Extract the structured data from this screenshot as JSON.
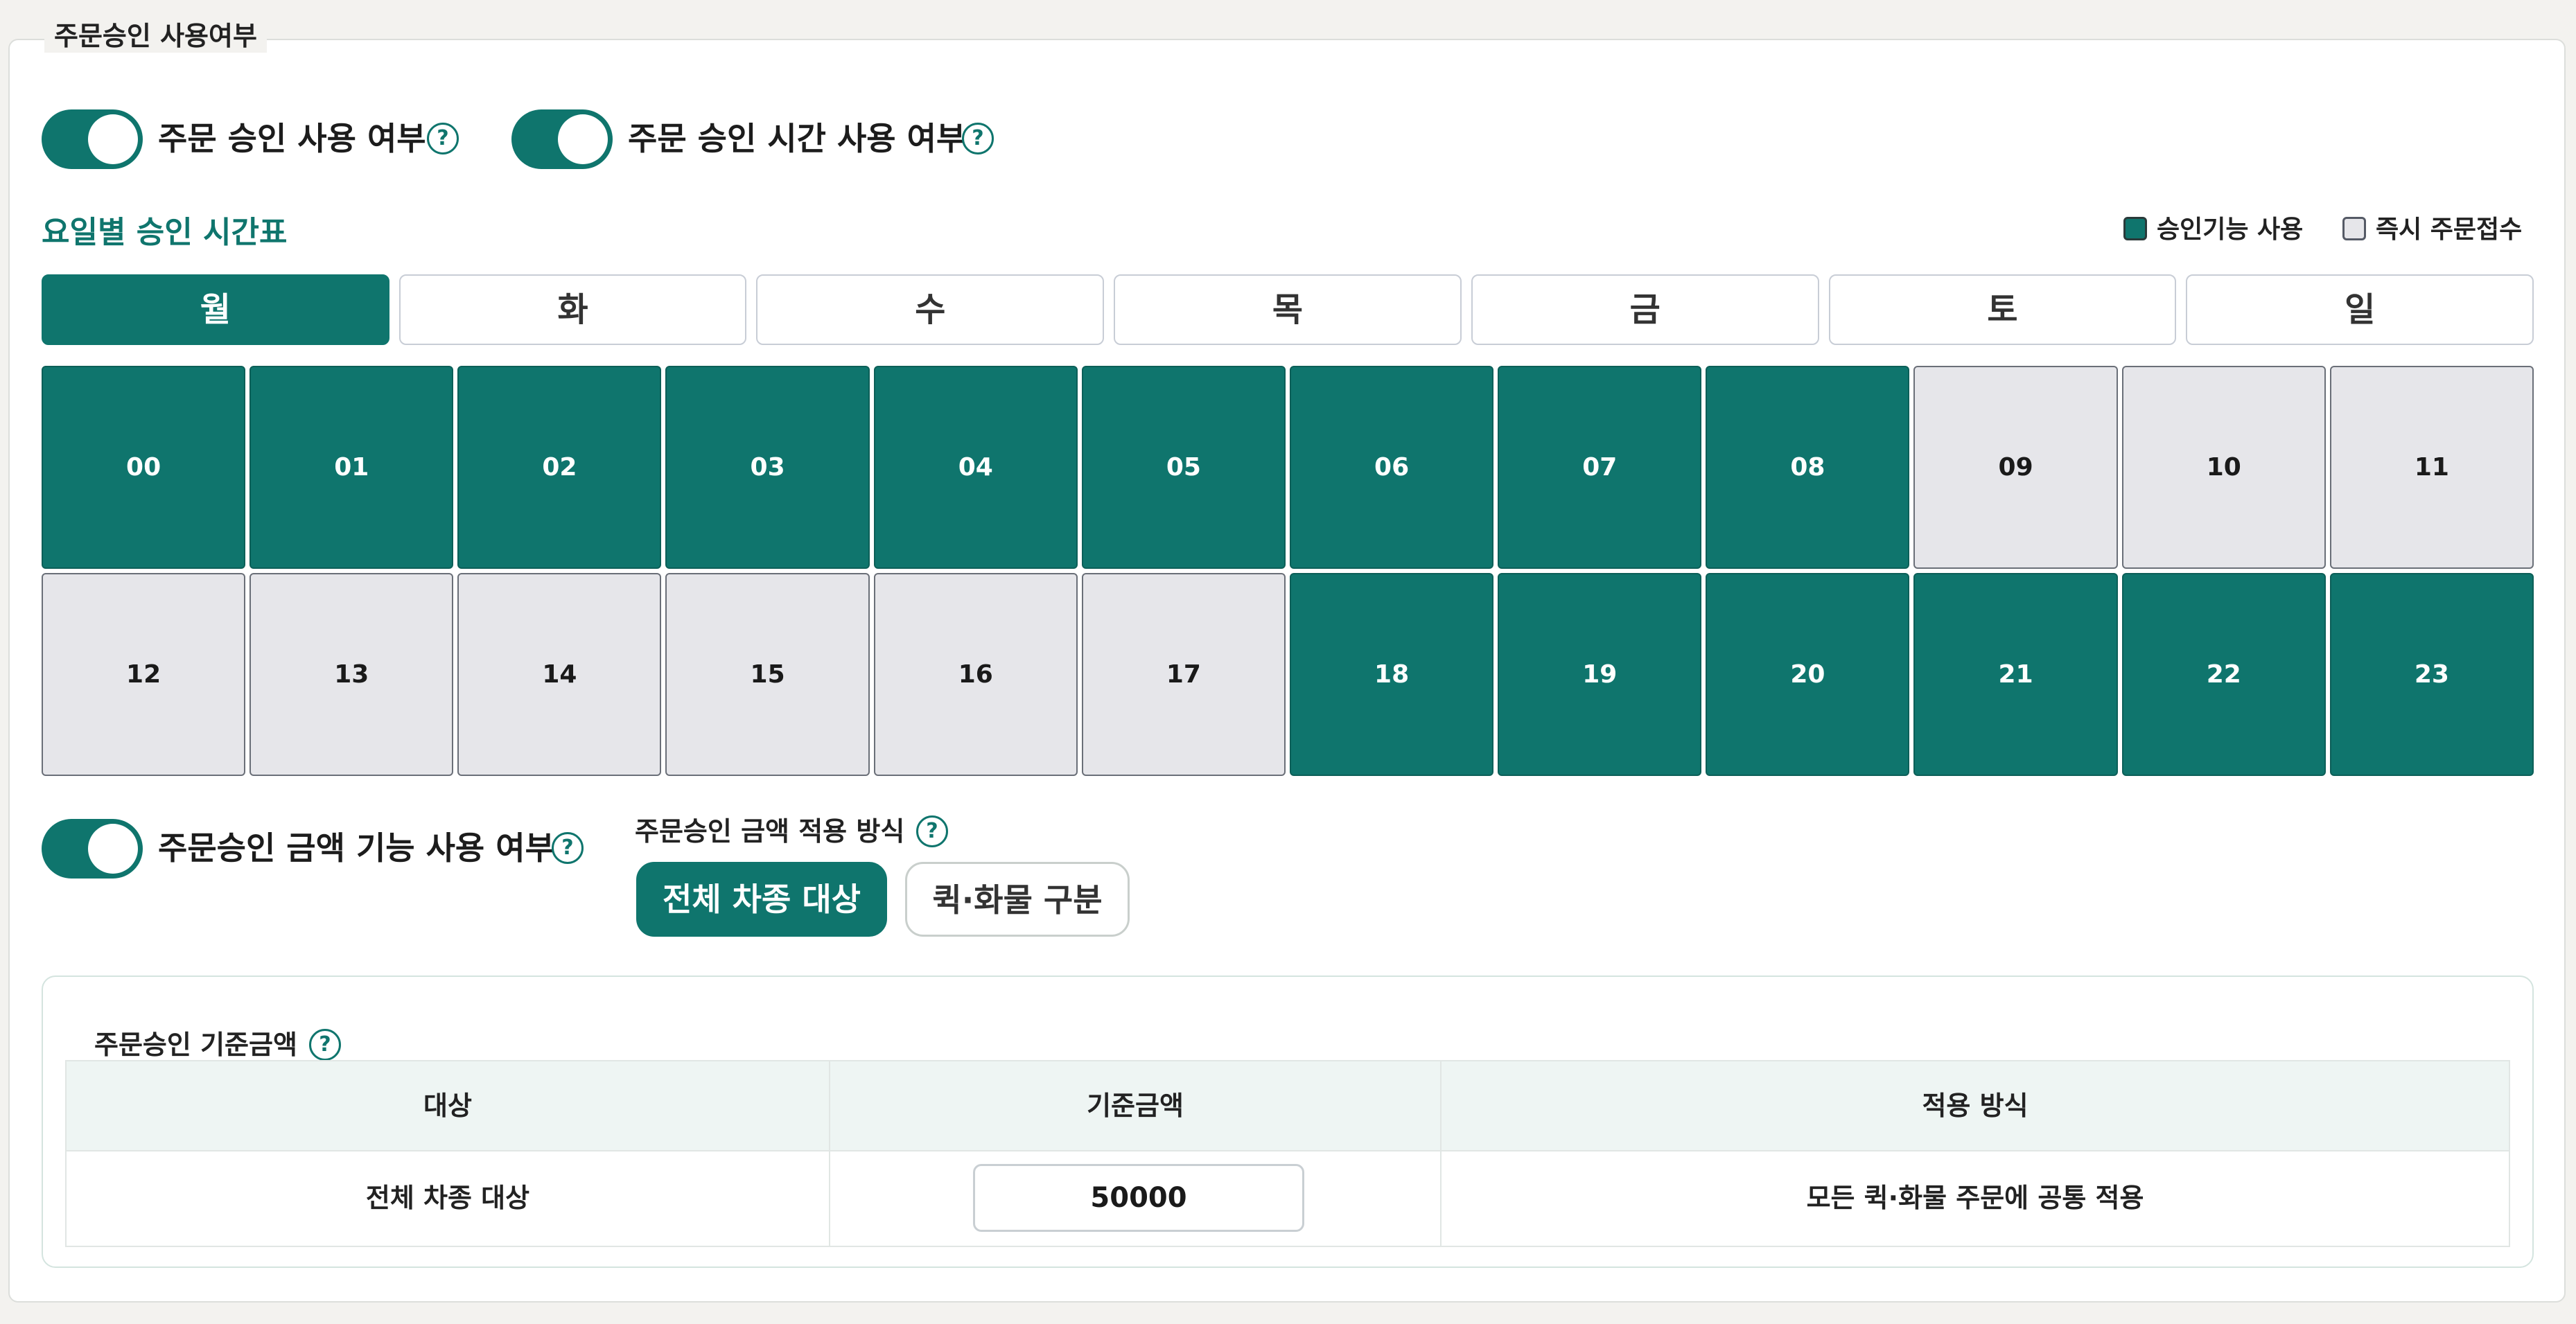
{
  "legend": "주문승인 사용여부",
  "toggles": {
    "approval_use": {
      "label": "주문 승인 사용 여부",
      "on": true
    },
    "approval_time_use": {
      "label": "주문 승인 시간 사용 여부",
      "on": true
    },
    "amount_use": {
      "label": "주문승인 금액 기능 사용 여부",
      "on": true
    }
  },
  "help_glyph": "?",
  "schedule": {
    "title": "요일별 승인 시간표",
    "legend_on": "승인기능 사용",
    "legend_off": "즉시 주문접수",
    "days": [
      "월",
      "화",
      "수",
      "목",
      "금",
      "토",
      "일"
    ],
    "selected_day": "월",
    "hours": [
      {
        "label": "00",
        "on": true
      },
      {
        "label": "01",
        "on": true
      },
      {
        "label": "02",
        "on": true
      },
      {
        "label": "03",
        "on": true
      },
      {
        "label": "04",
        "on": true
      },
      {
        "label": "05",
        "on": true
      },
      {
        "label": "06",
        "on": true
      },
      {
        "label": "07",
        "on": true
      },
      {
        "label": "08",
        "on": true
      },
      {
        "label": "09",
        "on": false
      },
      {
        "label": "10",
        "on": false
      },
      {
        "label": "11",
        "on": false
      },
      {
        "label": "12",
        "on": false
      },
      {
        "label": "13",
        "on": false
      },
      {
        "label": "14",
        "on": false
      },
      {
        "label": "15",
        "on": false
      },
      {
        "label": "16",
        "on": false
      },
      {
        "label": "17",
        "on": false
      },
      {
        "label": "18",
        "on": true
      },
      {
        "label": "19",
        "on": true
      },
      {
        "label": "20",
        "on": true
      },
      {
        "label": "21",
        "on": true
      },
      {
        "label": "22",
        "on": true
      },
      {
        "label": "23",
        "on": true
      }
    ]
  },
  "method": {
    "label": "주문승인 금액 적용 방식",
    "options": [
      "전체 차종 대상",
      "퀵·화물 구분"
    ],
    "selected": "전체 차종 대상"
  },
  "threshold": {
    "title": "주문승인 기준금액",
    "headers": [
      "대상",
      "기준금액",
      "적용 방식"
    ],
    "row": {
      "target": "전체 차종 대상",
      "amount": "50000",
      "applied": "모든 퀵·화물 주문에 공통 적용"
    }
  },
  "colors": {
    "accent": "#0f756d",
    "off_cell": "#e6e6ea"
  }
}
